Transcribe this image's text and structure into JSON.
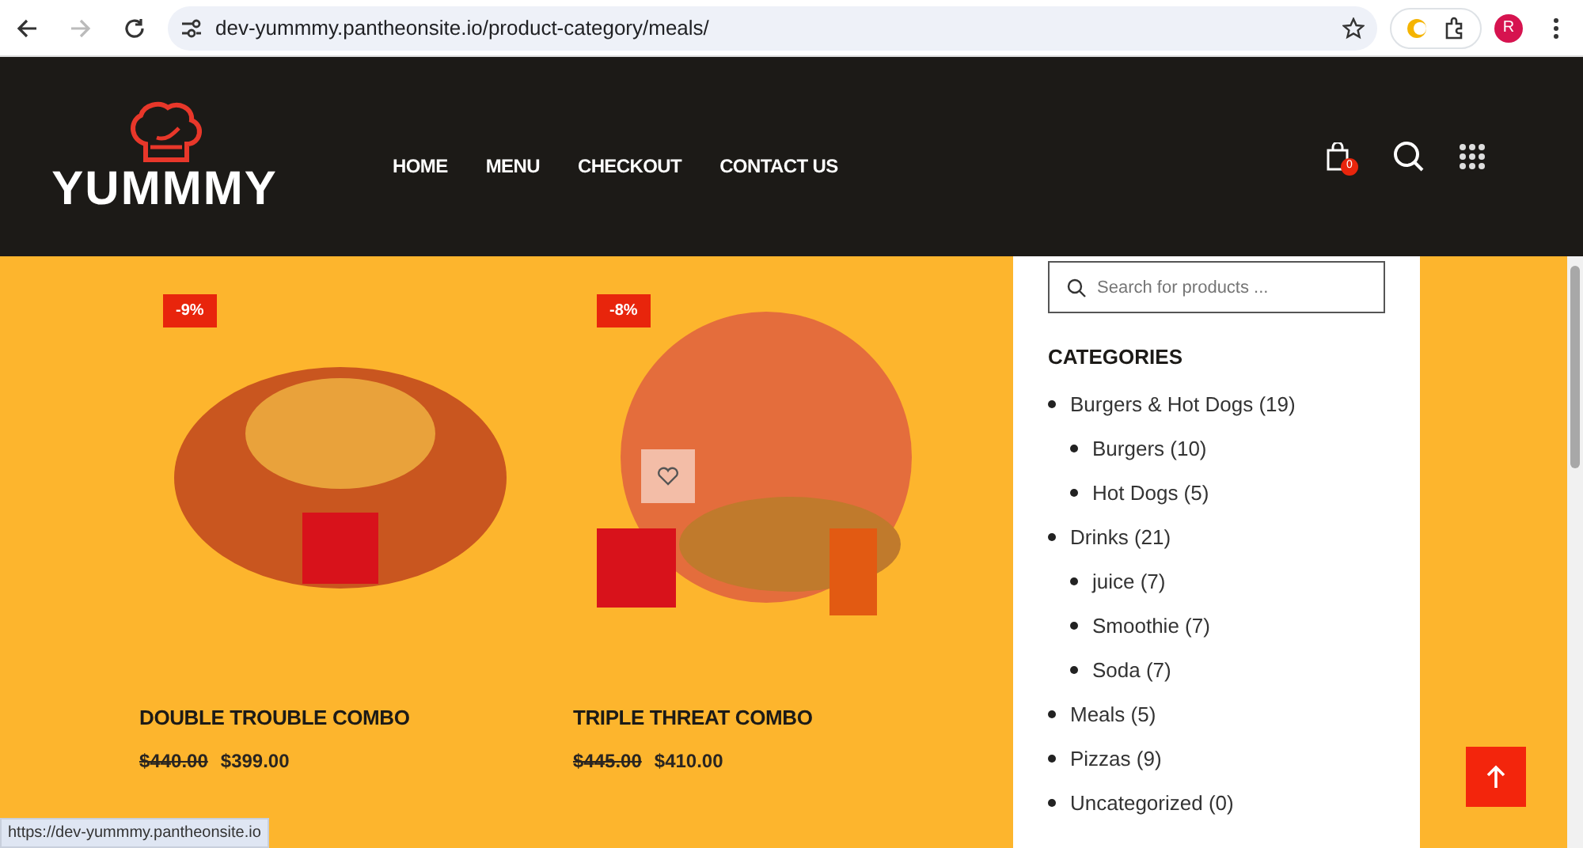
{
  "browser": {
    "url": "dev-yummmy.pantheonsite.io/product-category/meals/",
    "forward_disabled": true,
    "profile_letter": "R"
  },
  "header": {
    "logo": "YUMMMY",
    "nav": [
      "HOME",
      "MENU",
      "CHECKOUT",
      "CONTACT US"
    ],
    "cart_count": "0"
  },
  "products": [
    {
      "badge": "-9%",
      "title": "DOUBLE TROUBLE COMBO",
      "old_price": "$440.00",
      "price": "$399.00",
      "wishlist": false
    },
    {
      "badge": "-8%",
      "title": "TRIPLE THREAT COMBO",
      "old_price": "$445.00",
      "price": "$410.00",
      "wishlist": true
    }
  ],
  "sidebar": {
    "search_placeholder": "Search for products ...",
    "categories_title": "CATEGORIES",
    "categories": [
      {
        "label": "Burgers & Hot Dogs (19)",
        "children": [
          {
            "label": "Burgers (10)"
          },
          {
            "label": "Hot Dogs (5)"
          }
        ]
      },
      {
        "label": "Drinks (21)",
        "children": [
          {
            "label": "juice (7)"
          },
          {
            "label": "Smoothie (7)"
          },
          {
            "label": "Soda (7)"
          }
        ]
      },
      {
        "label": "Meals (5)"
      },
      {
        "label": "Pizzas (9)"
      },
      {
        "label": "Uncategorized (0)"
      }
    ]
  },
  "status_url": "https://dev-yummmy.pantheonsite.io"
}
